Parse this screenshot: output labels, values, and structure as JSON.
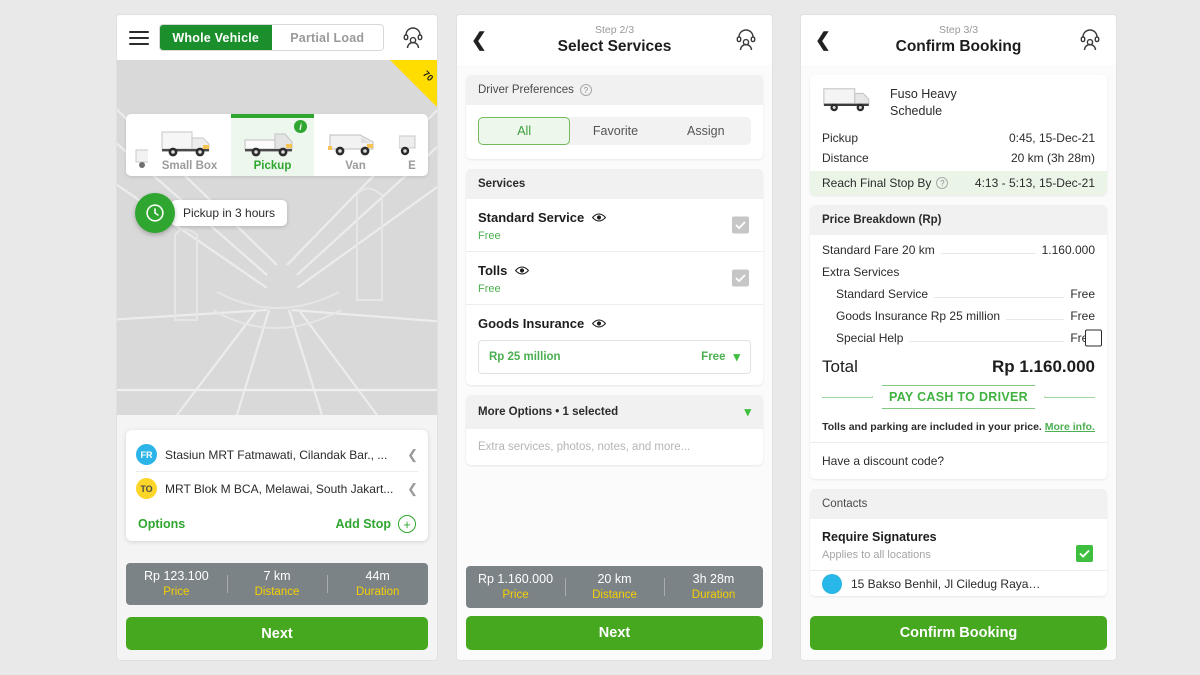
{
  "panel1": {
    "menu_icon": "hamburger-icon",
    "toggle": {
      "active": "Whole Vehicle",
      "inactive": "Partial Load"
    },
    "support_icon": "support-agent-icon",
    "vehicles": [
      {
        "label": "Small Box",
        "selected": false
      },
      {
        "label": "Pickup",
        "selected": true,
        "info_badge": "i"
      },
      {
        "label": "Van",
        "selected": false
      },
      {
        "label": "E",
        "selected": false
      }
    ],
    "clock_icon": "clock-icon",
    "pickup_note": "Pickup in 3 hours",
    "speed_badge": "70",
    "addresses": [
      {
        "badge": "FR",
        "text": "Stasiun MRT Fatmawati, Cilandak Bar., ..."
      },
      {
        "badge": "TO",
        "text": "MRT Blok M BCA, Melawai, South Jakart..."
      }
    ],
    "options_label": "Options",
    "add_stop_label": "Add Stop",
    "summary": [
      {
        "value": "Rp 123.100",
        "label": "Price"
      },
      {
        "value": "7 km",
        "label": "Distance"
      },
      {
        "value": "44m",
        "label": "Duration"
      }
    ],
    "next_label": "Next"
  },
  "panel2": {
    "back_icon": "back-chevron-icon",
    "step": "Step 2/3",
    "title": "Select Services",
    "support_icon": "support-agent-icon",
    "driver_pref": {
      "heading": "Driver Preferences",
      "tabs": [
        {
          "label": "All",
          "active": true
        },
        {
          "label": "Favorite",
          "active": false
        },
        {
          "label": "Assign",
          "active": false
        }
      ]
    },
    "services_heading": "Services",
    "services": [
      {
        "name": "Standard Service",
        "price": "Free",
        "checked": true,
        "locked": true
      },
      {
        "name": "Tolls",
        "price": "Free",
        "checked": true,
        "locked": true
      },
      {
        "name": "Goods Insurance",
        "selected_value": "Rp 25 million",
        "price": "Free"
      }
    ],
    "more_options": {
      "heading": "More Options • 1 selected",
      "placeholder": "Extra services, photos, notes, and more..."
    },
    "summary": [
      {
        "value": "Rp 1.160.000",
        "label": "Price"
      },
      {
        "value": "20 km",
        "label": "Distance"
      },
      {
        "value": "3h 28m",
        "label": "Duration"
      }
    ],
    "next_label": "Next"
  },
  "panel3": {
    "back_icon": "back-chevron-icon",
    "step": "Step 3/3",
    "title": "Confirm Booking",
    "support_icon": "support-agent-icon",
    "vehicle": {
      "name": "Fuso Heavy",
      "sub": "Schedule",
      "icon": "truck-icon"
    },
    "details": [
      {
        "key": "Pickup",
        "value": "0:45, 15-Dec-21",
        "highlight": false
      },
      {
        "key": "Distance",
        "value": "20 km (3h 28m)",
        "highlight": false
      },
      {
        "key": "Reach Final Stop By",
        "value": "4:13 - 5:13, 15-Dec-21",
        "highlight": true,
        "help": true
      }
    ],
    "price_breakdown": {
      "heading": "Price Breakdown (Rp)",
      "rows": [
        {
          "label": "Standard Fare 20 km",
          "value": "1.160.000",
          "indent": false,
          "dots": true
        },
        {
          "label": "Extra Services",
          "value": "",
          "indent": false,
          "dots": false
        },
        {
          "label": "Standard Service",
          "value": "Free",
          "indent": true,
          "dots": true
        },
        {
          "label": "Goods Insurance Rp 25 million",
          "value": "Free",
          "indent": true,
          "dots": true
        },
        {
          "label": "Special Help",
          "value": "Free",
          "indent": true,
          "dots": true
        }
      ],
      "total_label": "Total",
      "total_value": "Rp 1.160.000",
      "pay_method": "PAY CASH TO DRIVER",
      "tolls_note": "Tolls and parking are included in your price.",
      "tolls_link": "More info.",
      "discount_label": "Have a discount code?"
    },
    "contacts": {
      "heading": "Contacts",
      "signature_title": "Require Signatures",
      "signature_sub": "Applies to all locations",
      "signature_checked": true,
      "cut_contact": "15 Bakso Benhil, Jl Ciledug Raya…"
    },
    "confirm_label": "Confirm Booking"
  },
  "colors": {
    "brand_dark_green": "#1b8f2c",
    "brand_green": "#45a81e",
    "accent_green": "#3fbf3f",
    "summary_bar": "#7c8387",
    "summary_label_yellow": "#f5d000",
    "badge_from": "#2bb4e8",
    "badge_to": "#fbd528",
    "speed_yellow": "#ffdd00",
    "page_bg": "#e9e9e9"
  }
}
